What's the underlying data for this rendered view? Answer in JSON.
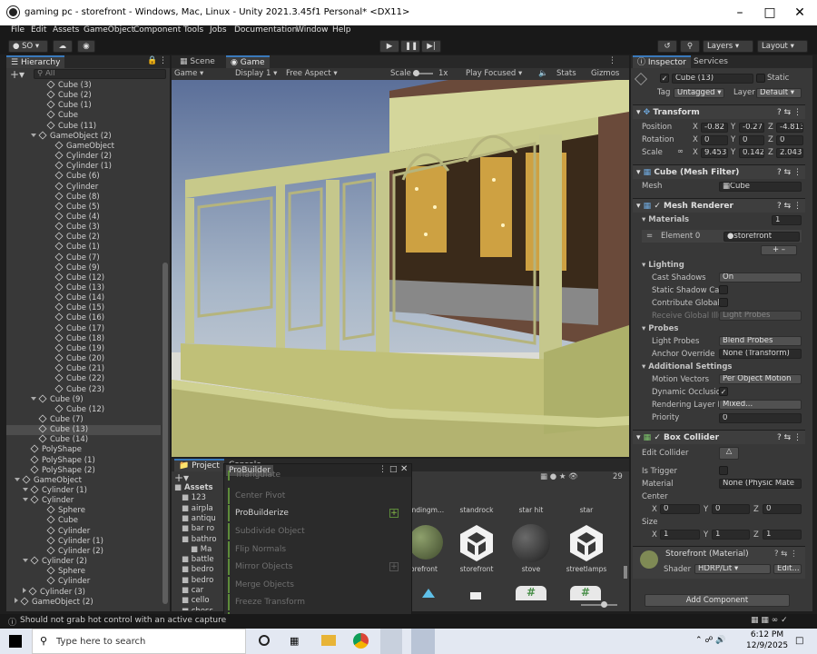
{
  "window": {
    "title": "gaming pc - storefront - Windows, Mac, Linux - Unity 2021.3.45f1 Personal* <DX11>"
  },
  "menu": [
    "File",
    "Edit",
    "Assets",
    "GameObject",
    "Component",
    "Tools",
    "Jobs",
    "Documentation",
    "Window",
    "Help"
  ],
  "toolbar": {
    "account": "SO",
    "layers": "Layers",
    "layout": "Layout"
  },
  "hierarchy": {
    "tab": "Hierarchy",
    "search_placeholder": "All",
    "rows": [
      {
        "label": "Cube (3)",
        "indent": 5,
        "icon": "cube"
      },
      {
        "label": "Cube (2)",
        "indent": 5,
        "icon": "cube"
      },
      {
        "label": "Cube (1)",
        "indent": 5,
        "icon": "cube"
      },
      {
        "label": "Cube",
        "indent": 5,
        "icon": "cube"
      },
      {
        "label": "Cube (11)",
        "indent": 5,
        "icon": "cube"
      },
      {
        "label": "GameObject (2)",
        "indent": 4,
        "icon": "cube",
        "arrow": "down"
      },
      {
        "label": "GameObject",
        "indent": 6,
        "icon": "cube"
      },
      {
        "label": "Cylinder (2)",
        "indent": 6,
        "icon": "cube"
      },
      {
        "label": "Cylinder (1)",
        "indent": 6,
        "icon": "cube"
      },
      {
        "label": "Cube (6)",
        "indent": 6,
        "icon": "cube"
      },
      {
        "label": "Cylinder",
        "indent": 6,
        "icon": "cube"
      },
      {
        "label": "Cube (8)",
        "indent": 6,
        "icon": "cube"
      },
      {
        "label": "Cube (5)",
        "indent": 6,
        "icon": "cube"
      },
      {
        "label": "Cube (4)",
        "indent": 6,
        "icon": "cube"
      },
      {
        "label": "Cube (3)",
        "indent": 6,
        "icon": "cube"
      },
      {
        "label": "Cube (2)",
        "indent": 6,
        "icon": "cube"
      },
      {
        "label": "Cube (1)",
        "indent": 6,
        "icon": "cube"
      },
      {
        "label": "Cube (7)",
        "indent": 6,
        "icon": "cube"
      },
      {
        "label": "Cube (9)",
        "indent": 6,
        "icon": "cube"
      },
      {
        "label": "Cube (12)",
        "indent": 6,
        "icon": "cube"
      },
      {
        "label": "Cube (13)",
        "indent": 6,
        "icon": "cube"
      },
      {
        "label": "Cube (14)",
        "indent": 6,
        "icon": "cube"
      },
      {
        "label": "Cube (15)",
        "indent": 6,
        "icon": "cube"
      },
      {
        "label": "Cube (16)",
        "indent": 6,
        "icon": "cube"
      },
      {
        "label": "Cube (17)",
        "indent": 6,
        "icon": "cube"
      },
      {
        "label": "Cube (18)",
        "indent": 6,
        "icon": "cube"
      },
      {
        "label": "Cube (19)",
        "indent": 6,
        "icon": "cube"
      },
      {
        "label": "Cube (20)",
        "indent": 6,
        "icon": "cube"
      },
      {
        "label": "Cube (21)",
        "indent": 6,
        "icon": "cube"
      },
      {
        "label": "Cube (22)",
        "indent": 6,
        "icon": "cube"
      },
      {
        "label": "Cube (23)",
        "indent": 6,
        "icon": "cube"
      },
      {
        "label": "Cube (9)",
        "indent": 4,
        "icon": "cube",
        "arrow": "down"
      },
      {
        "label": "Cube (12)",
        "indent": 6,
        "icon": "cube"
      },
      {
        "label": "Cube (7)",
        "indent": 4,
        "icon": "cube"
      },
      {
        "label": "Cube (13)",
        "indent": 4,
        "icon": "cube",
        "selected": true
      },
      {
        "label": "Cube (14)",
        "indent": 4,
        "icon": "cube"
      },
      {
        "label": "PolyShape",
        "indent": 3,
        "icon": "cube"
      },
      {
        "label": "PolyShape (1)",
        "indent": 3,
        "icon": "cube"
      },
      {
        "label": "PolyShape (2)",
        "indent": 3,
        "icon": "cube"
      },
      {
        "label": "GameObject",
        "indent": 2,
        "icon": "cube",
        "arrow": "down"
      },
      {
        "label": "Cylinder (1)",
        "indent": 3,
        "icon": "cube",
        "arrow": "down"
      },
      {
        "label": "Cylinder",
        "indent": 3,
        "icon": "cube",
        "arrow": "down"
      },
      {
        "label": "Sphere",
        "indent": 5,
        "icon": "cube"
      },
      {
        "label": "Cube",
        "indent": 5,
        "icon": "cube"
      },
      {
        "label": "Cylinder",
        "indent": 5,
        "icon": "cube"
      },
      {
        "label": "Cylinder (1)",
        "indent": 5,
        "icon": "cube"
      },
      {
        "label": "Cylinder (2)",
        "indent": 5,
        "icon": "cube"
      },
      {
        "label": "Cylinder (2)",
        "indent": 3,
        "icon": "cube",
        "arrow": "down"
      },
      {
        "label": "Sphere",
        "indent": 5,
        "icon": "cube"
      },
      {
        "label": "Cylinder",
        "indent": 5,
        "icon": "cube"
      },
      {
        "label": "Cylinder (3)",
        "indent": 3,
        "icon": "cube",
        "arrow": "right"
      },
      {
        "label": "GameObject (2)",
        "indent": 2,
        "icon": "cube",
        "arrow": "right"
      }
    ]
  },
  "scene_tabs": {
    "scene": "Scene",
    "game": "Game"
  },
  "game_bar": {
    "display_mode": "Game",
    "display": "Display 1",
    "aspect": "Free Aspect",
    "scale_label": "Scale",
    "scale_value": "1x",
    "play_mode": "Play Focused",
    "stats": "Stats",
    "gizmos": "Gizmos"
  },
  "inspector": {
    "tabs": [
      "Inspector",
      "Services"
    ],
    "object_name": "Cube (13)",
    "static_label": "Static",
    "tag_label": "Tag",
    "tag_value": "Untagged",
    "layer_label": "Layer",
    "layer_value": "Default",
    "transform": {
      "title": "Transform",
      "position_label": "Position",
      "position": [
        "-0.82",
        "-0.27",
        "-4.813"
      ],
      "rotation_label": "Rotation",
      "rotation": [
        "0",
        "0",
        "0"
      ],
      "scale_label": "Scale",
      "scale": [
        "9.453",
        "0.142",
        "2.043"
      ]
    },
    "mesh_filter": {
      "title": "Cube (Mesh Filter)",
      "mesh_label": "Mesh",
      "mesh_value": "Cube"
    },
    "mesh_renderer": {
      "title": "Mesh Renderer",
      "materials_label": "Materials",
      "materials_count": "1",
      "element_label": "Element 0",
      "element_value": "storefront",
      "lighting_label": "Lighting",
      "cast_shadows_label": "Cast Shadows",
      "cast_shadows_value": "On",
      "static_shadow_label": "Static Shadow Cas",
      "contribute_gi_label": "Contribute Global I",
      "receive_gi_label": "Receive Global Illu",
      "receive_gi_value": "Light Probes",
      "probes_label": "Probes",
      "light_probes_label": "Light Probes",
      "light_probes_value": "Blend Probes",
      "anchor_label": "Anchor Override",
      "anchor_value": "None (Transform)",
      "additional_label": "Additional Settings",
      "motion_label": "Motion Vectors",
      "motion_value": "Per Object Motion",
      "dynamic_occ_label": "Dynamic Occlusion",
      "rendering_layer_label": "Rendering Layer M",
      "rendering_layer_value": "Mixed...",
      "priority_label": "Priority",
      "priority_value": "0"
    },
    "box_collider": {
      "title": "Box Collider",
      "edit_label": "Edit Collider",
      "trigger_label": "Is Trigger",
      "material_label": "Material",
      "material_value": "None (Physic Mate",
      "center_label": "Center",
      "center": [
        "0",
        "0",
        "0"
      ],
      "size_label": "Size",
      "size": [
        "1",
        "1",
        "1"
      ]
    },
    "material": {
      "title": "Storefront (Material)",
      "shader_label": "Shader",
      "shader_value": "HDRP/Lit",
      "edit_label": "Edit..."
    },
    "add_component": "Add Component"
  },
  "project": {
    "tab": "Project",
    "console_tab": "Console",
    "count": "29",
    "folders": [
      "Assets",
      "123",
      "airpla",
      "antiqu",
      "bar ro",
      "bathro",
      "Ma",
      "battle",
      "bedro",
      "bedro",
      "car",
      "cello",
      "chess"
    ],
    "assets": [
      {
        "label": "andingm..."
      },
      {
        "label": "standrock"
      },
      {
        "label": "star hit"
      },
      {
        "label": "star"
      }
    ],
    "assets_row2": [
      {
        "label": "orefront"
      },
      {
        "label": "storefront"
      },
      {
        "label": "stove"
      },
      {
        "label": "streetlamps"
      }
    ]
  },
  "probuilder": {
    "title": "ProBuilder",
    "items": [
      "Triangulate",
      "Center Pivot",
      "ProBuilderize",
      "Subdivide Object",
      "Flip Normals",
      "Mirror Objects",
      "Merge Objects",
      "Freeze Transform",
      "Set Trigger"
    ]
  },
  "status": {
    "message": "Should not grab hot control with an active capture"
  },
  "taskbar": {
    "search_placeholder": "Type here to search",
    "time": "6:12 PM",
    "date": "12/9/2025"
  }
}
